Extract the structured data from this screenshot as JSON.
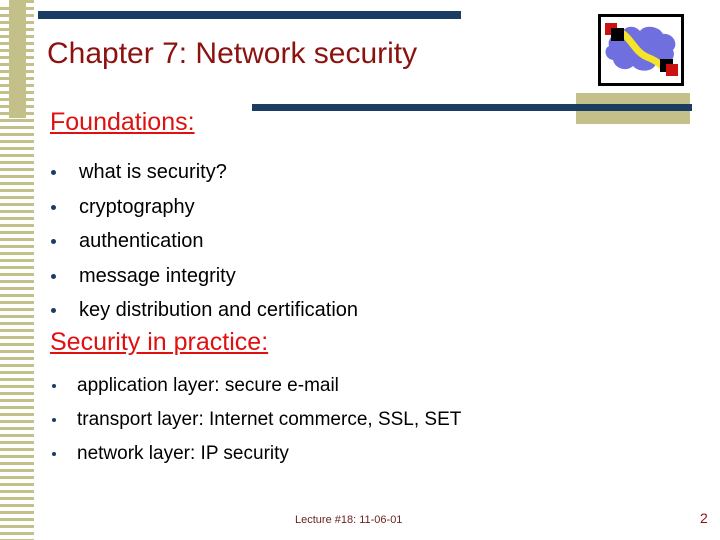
{
  "slide": {
    "title": "Chapter 7: Network security",
    "sections": [
      {
        "heading": "Foundations:",
        "bullets": [
          "what is security?",
          "cryptography",
          "authentication",
          "message integrity",
          "key distribution and certification"
        ]
      },
      {
        "heading": "Security in practice:",
        "bullets": [
          "application layer: secure e-mail",
          "transport layer: Internet commerce, SSL, SET",
          "network layer: IP security"
        ]
      }
    ],
    "footer": {
      "note": "Lecture #18: 11-06-01",
      "page_number": "2"
    },
    "logo": {
      "name": "network-cloud-logo",
      "cloud_color": "#6f6fe0",
      "link_color": "#f5e42a",
      "endpoint_colors": [
        "#cc1111",
        "#000000"
      ],
      "border_color": "#000000"
    },
    "theme": {
      "title_color": "#8c1210",
      "heading_color": "#e01010",
      "body_color": "#000000",
      "rule_color": "#1b3c63",
      "accent_khaki": "#c3c08a",
      "bullet_color": "#1b3c63",
      "footer_color": "#6b2320",
      "background": "#ffffff"
    }
  }
}
